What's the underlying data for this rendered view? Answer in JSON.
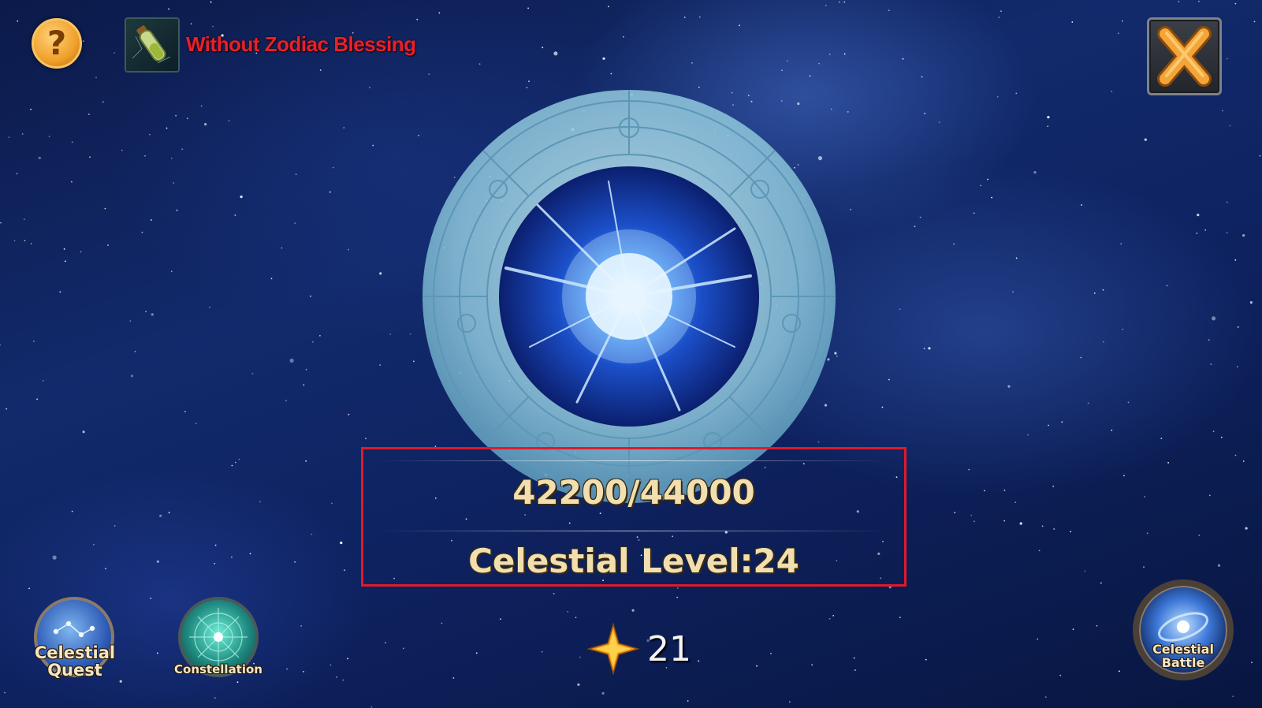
{
  "header": {
    "help_icon": "question-mark-icon",
    "blessing_icon": "potion-vial-icon",
    "blessing_status": "Without Zodiac Blessing",
    "close_icon": "close-x-icon"
  },
  "celestial": {
    "exp_current": 42200,
    "exp_max": 44000,
    "exp_text": "42200/44000",
    "level_text": "Celestial Level:24"
  },
  "currency": {
    "icon": "star-icon",
    "count": "21"
  },
  "nav": {
    "celestial_quest_line1": "Celestial",
    "celestial_quest_line2": "Quest",
    "constellation": "Constellation",
    "celestial_battle_line1": "Celestial",
    "celestial_battle_line2": "Battle"
  },
  "colors": {
    "blessing_text": "#e8202a",
    "panel_border": "#e01a2a",
    "gold_text": "#f1dfb0"
  }
}
